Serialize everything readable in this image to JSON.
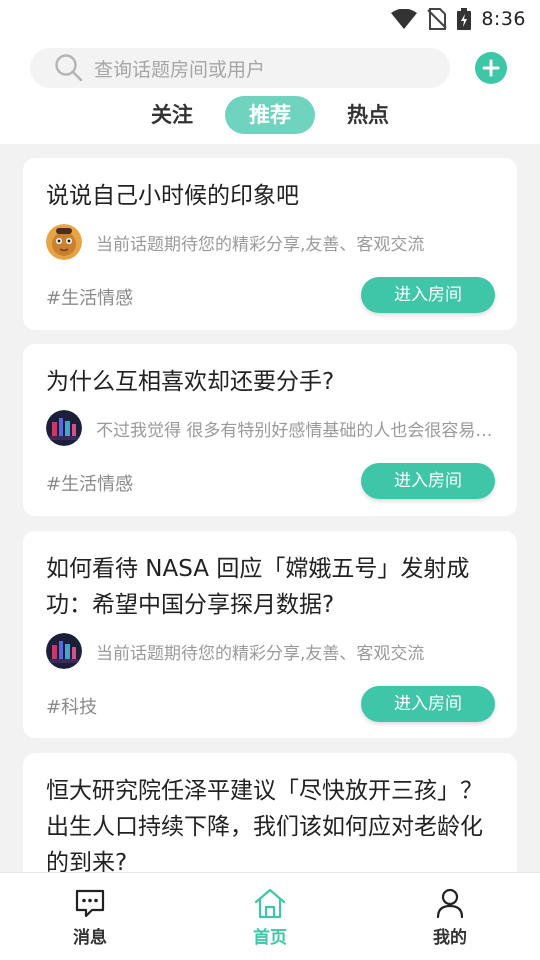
{
  "status_bar": {
    "time": "8:36"
  },
  "search": {
    "placeholder": "查询话题房间或用户"
  },
  "tabs": [
    {
      "label": "关注",
      "active": false
    },
    {
      "label": "推荐",
      "active": true
    },
    {
      "label": "热点",
      "active": false
    }
  ],
  "cards": [
    {
      "title": "说说自己小时候的印象吧",
      "reply": "当前话题期待您的精彩分享,友善、客观交流",
      "tag": "#生活情感",
      "button": "进入房间"
    },
    {
      "title": "为什么互相喜欢却还要分手?",
      "reply": "不过我觉得 很多有特别好感情基础的人也会很容易因为一些小事分手",
      "tag": "#生活情感",
      "button": "进入房间"
    },
    {
      "title": "如何看待 NASA 回应「嫦娥五号」发射成功：希望中国分享探月数据?",
      "reply": "当前话题期待您的精彩分享,友善、客观交流",
      "tag": "#科技",
      "button": "进入房间"
    },
    {
      "title": "恒大研究院任泽平建议「尽快放开三孩」？出生人口持续下降，我们该如何应对老龄化的到来?"
    }
  ],
  "bottom_nav": [
    {
      "label": "消息",
      "active": false,
      "icon": "chat-icon"
    },
    {
      "label": "首页",
      "active": true,
      "icon": "home-icon"
    },
    {
      "label": "我的",
      "active": false,
      "icon": "user-icon"
    }
  ],
  "colors": {
    "accent": "#3fc6a8",
    "tab_active_bg": "#6fd3bf"
  }
}
